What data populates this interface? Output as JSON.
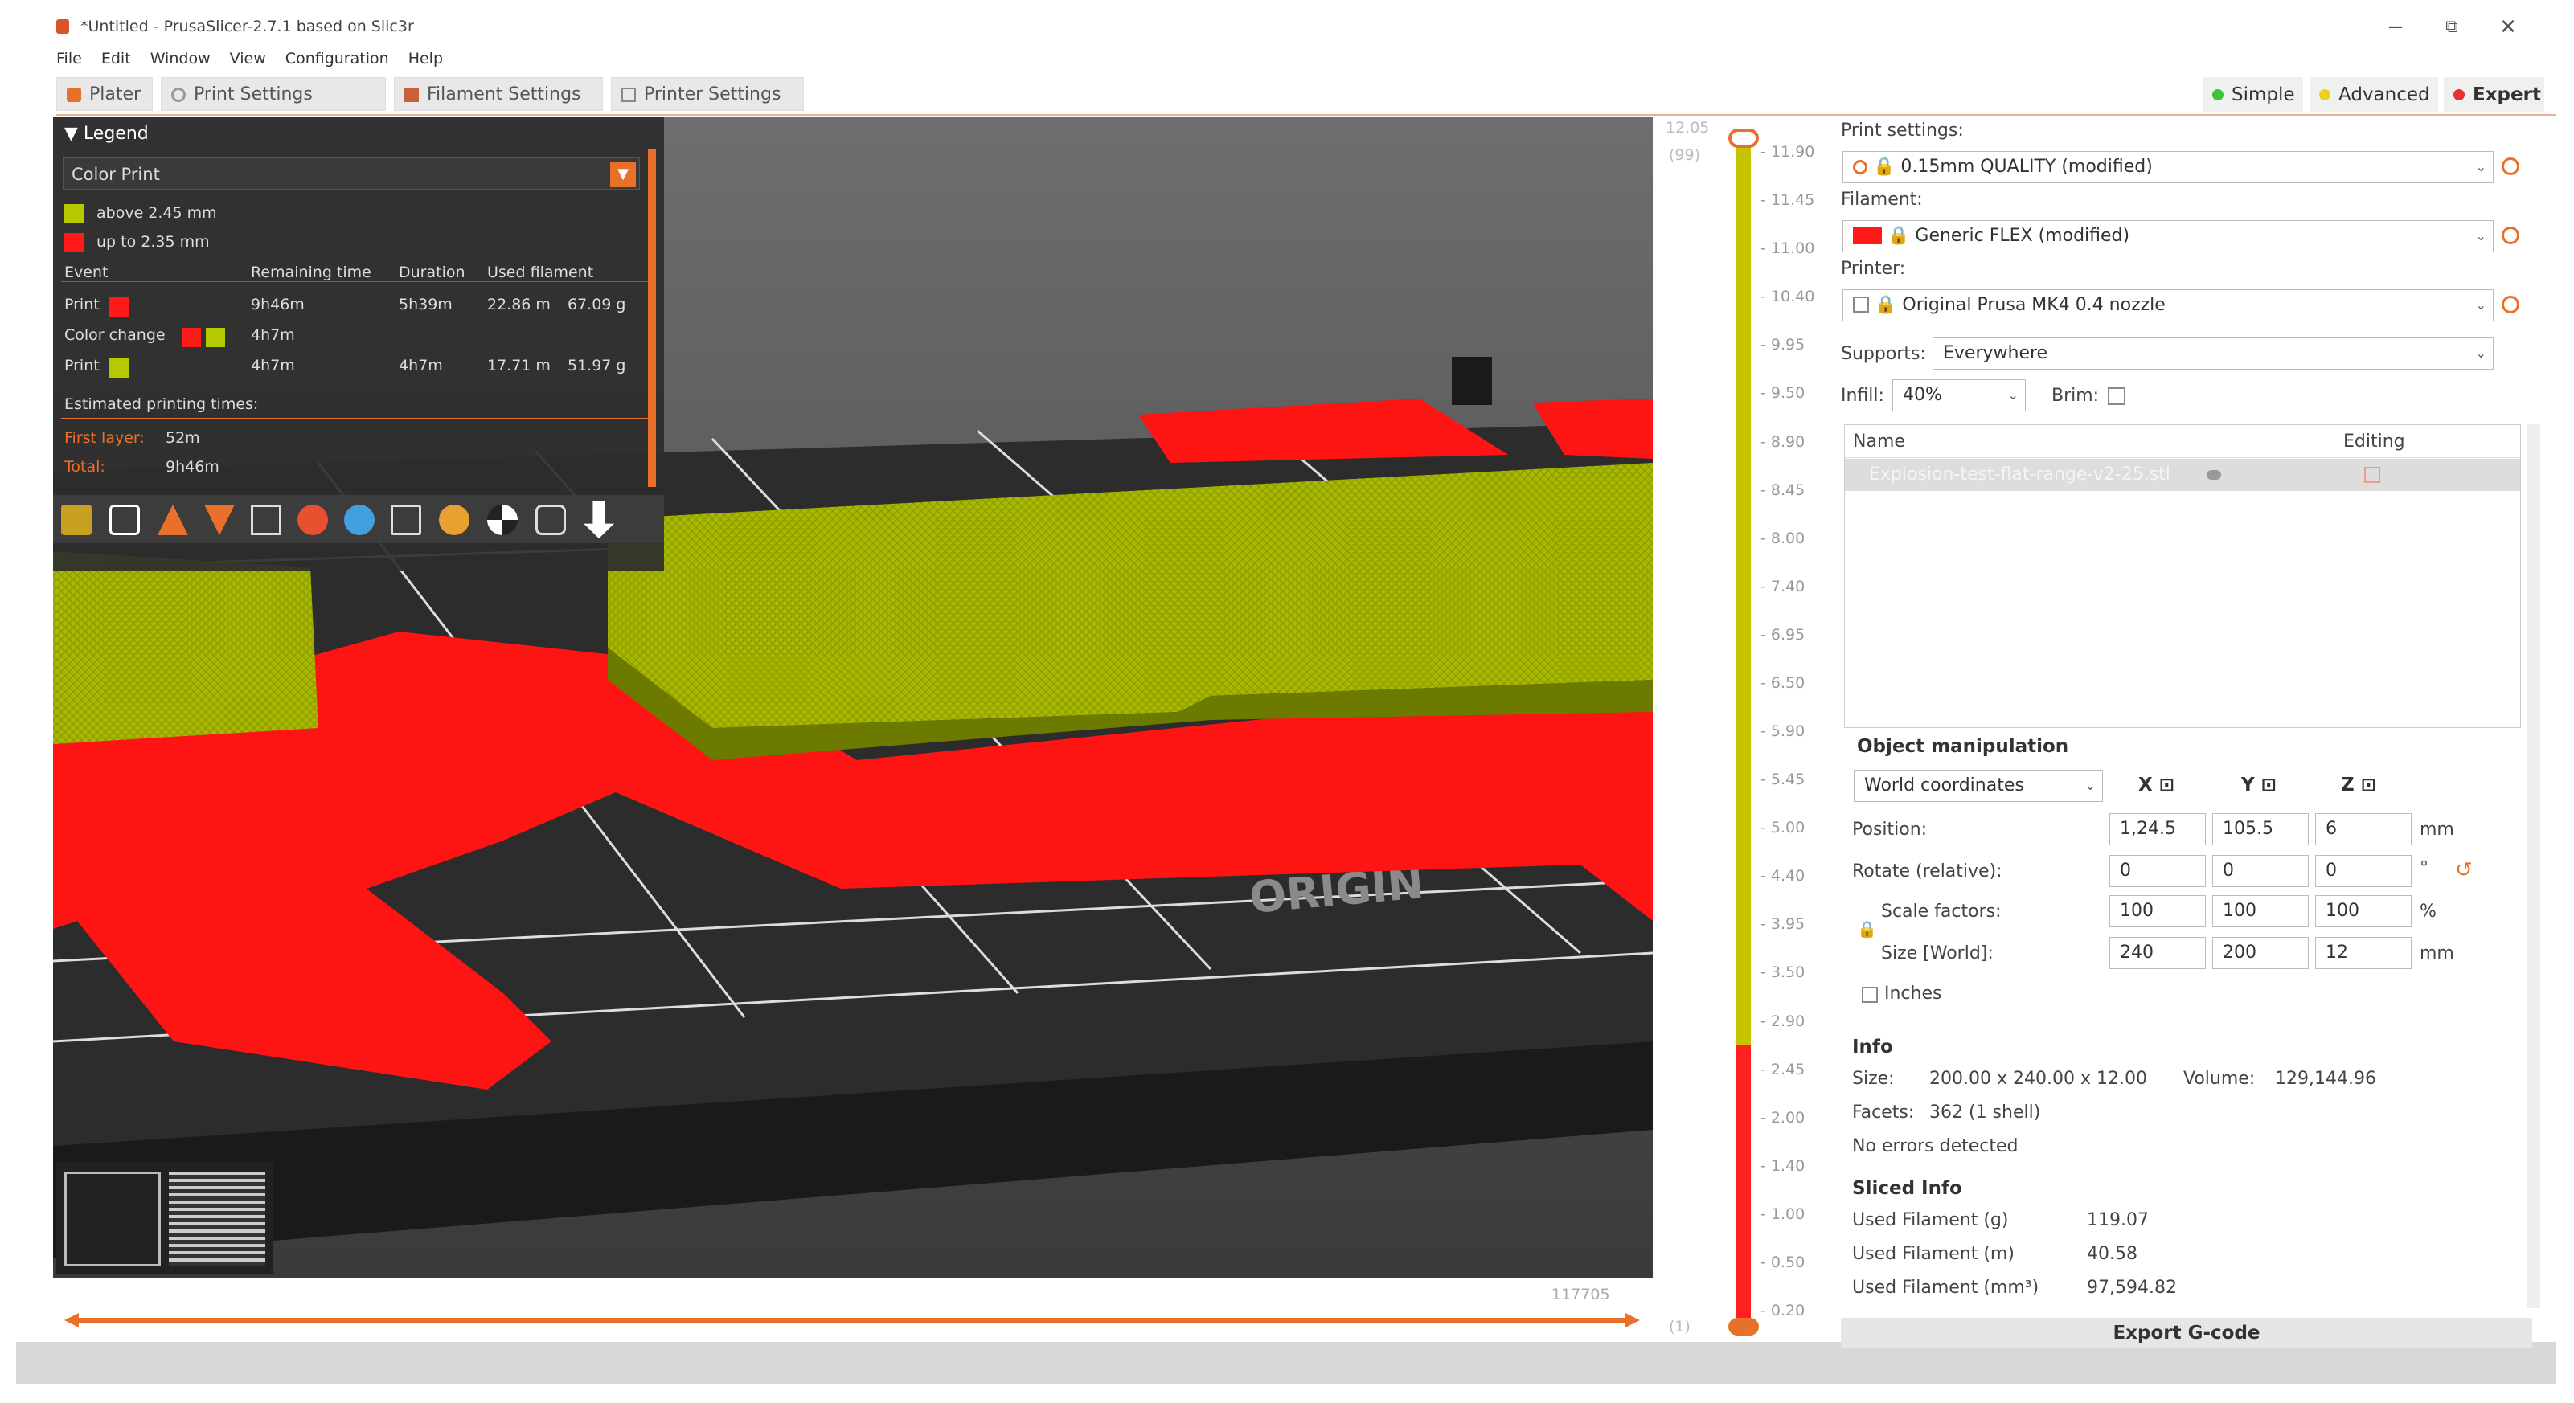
{
  "window": {
    "title": "*Untitled - PrusaSlicer-2.7.1 based on Slic3r",
    "minimize": "−",
    "maximize": "⧉",
    "close": "✕"
  },
  "menu": [
    "File",
    "Edit",
    "Window",
    "View",
    "Configuration",
    "Help"
  ],
  "tabs": [
    {
      "label": "Plater",
      "icon": "plater-icon"
    },
    {
      "label": "Print Settings",
      "icon": "gear-icon"
    },
    {
      "label": "Filament Settings",
      "icon": "spool-icon"
    },
    {
      "label": "Printer Settings",
      "icon": "printer-icon"
    }
  ],
  "modes": [
    {
      "label": "Simple",
      "color": "#3cc43c"
    },
    {
      "label": "Advanced",
      "color": "#f0d020"
    },
    {
      "label": "Expert",
      "color": "#e83030"
    }
  ],
  "legend": {
    "title": "Legend",
    "view_type": "Color Print",
    "ranges": [
      {
        "label": "above 2.45 mm",
        "color": "#b5c800"
      },
      {
        "label": "up to 2.35 mm",
        "color": "#ff1a1a"
      }
    ],
    "columns": [
      "Event",
      "Remaining time",
      "Duration",
      "Used filament"
    ],
    "rows": [
      {
        "event": "Print",
        "remaining": "9h46m",
        "duration": "5h39m",
        "length": "22.86 m",
        "weight": "67.09 g"
      },
      {
        "event": "Color change",
        "remaining": "4h7m",
        "duration": "",
        "length": "",
        "weight": ""
      },
      {
        "event": "Print",
        "remaining": "4h7m",
        "duration": "4h7m",
        "length": "17.71 m",
        "weight": "51.97 g"
      }
    ],
    "estimated_label": "Estimated printing times:",
    "first_layer_label": "First layer:",
    "first_layer_value": "52m",
    "total_label": "Total:",
    "total_value": "9h46m"
  },
  "toolbar_icons": [
    "feature-type-icon",
    "height-icon",
    "width-icon",
    "speed-icon",
    "fan-icon",
    "temperature-icon",
    "volumetric-icon",
    "layer-time-icon",
    "tool-icon",
    "color-print-icon",
    "shells-icon",
    "sequential-icon"
  ],
  "viewport": {
    "bed_text": "ORIGIN",
    "view_3d_icon": "cube-icon",
    "view_preview_icon": "layers-icon",
    "hslider_value": "117705"
  },
  "vslider": {
    "top_value": "12.05",
    "top_layer": "(99)",
    "ticks": [
      "11.90",
      "11.45",
      "11.00",
      "10.40",
      "9.95",
      "9.50",
      "8.90",
      "8.45",
      "8.00",
      "7.40",
      "6.95",
      "6.50",
      "5.90",
      "5.45",
      "5.00",
      "4.40",
      "3.95",
      "3.50",
      "2.90",
      "2.45",
      "2.00",
      "1.40",
      "1.00",
      "0.50",
      "0.20"
    ],
    "bottom_layer": "(1)"
  },
  "sidebar": {
    "print_settings_label": "Print settings:",
    "print_profile": "0.15mm QUALITY (modified)",
    "filament_label": "Filament:",
    "filament_profile": "Generic FLEX (modified)",
    "filament_color": "#ff1a1a",
    "printer_label": "Printer:",
    "printer_profile": "Original Prusa MK4 0.4 nozzle",
    "supports_label": "Supports:",
    "supports_value": "Everywhere",
    "infill_label": "Infill:",
    "infill_value": "40%",
    "brim_label": "Brim:",
    "list_name_header": "Name",
    "list_editing_header": "Editing",
    "list_item": "Explosion-test-flat-range-v2-25.stl",
    "object_manipulation": "Object manipulation",
    "coords": "World coordinates",
    "axis_x": "X",
    "axis_y": "Y",
    "axis_z": "Z",
    "position_label": "Position:",
    "position": [
      "1,24.5",
      "105.5",
      "6"
    ],
    "position_unit": "mm",
    "rotate_label": "Rotate (relative):",
    "rotate": [
      "0",
      "0",
      "0"
    ],
    "rotate_unit": "°",
    "scale_label": "Scale factors:",
    "scale": [
      "100",
      "100",
      "100"
    ],
    "scale_unit": "%",
    "size_label": "Size [World]:",
    "size": [
      "240",
      "200",
      "12"
    ],
    "size_unit": "mm",
    "inches_label": "Inches",
    "info_title": "Info",
    "info_size_label": "Size:",
    "info_size_value": "200.00 x 240.00 x 12.00",
    "info_volume_label": "Volume:",
    "info_volume_value": "129,144.96",
    "info_facets_label": "Facets:",
    "info_facets_value": "362 (1 shell)",
    "info_errors": "No errors detected",
    "sliced_title": "Sliced Info",
    "sliced_g_label": "Used Filament (g)",
    "sliced_g_value": "119.07",
    "sliced_m_label": "Used Filament (m)",
    "sliced_m_value": "40.58",
    "sliced_mm3_label": "Used Filament (mm³)",
    "sliced_mm3_value": "97,594.82",
    "export_button": "Export G-code"
  }
}
